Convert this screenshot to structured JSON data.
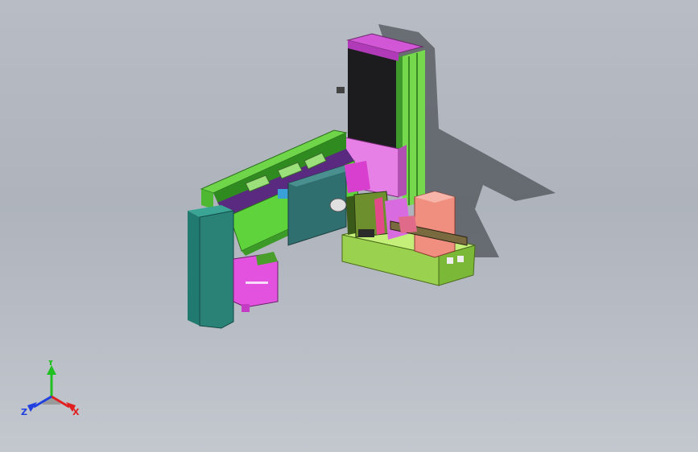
{
  "viewport": {
    "background_top": "#b8bcc4",
    "background_bottom": "#c3c7ce"
  },
  "model": {
    "parts": [
      {
        "name": "vertical-column",
        "color": "#2f2f33"
      },
      {
        "name": "column-cap",
        "color": "#d157d6"
      },
      {
        "name": "column-rail",
        "color": "#6fd64a"
      },
      {
        "name": "horizontal-beam",
        "color": "#5ed33c"
      },
      {
        "name": "carriage-plate",
        "color": "#2f6f6f"
      },
      {
        "name": "end-block",
        "color": "#2a8277"
      },
      {
        "name": "motor-housing",
        "color": "#e252de"
      },
      {
        "name": "base-plate",
        "color": "#a6e35c"
      },
      {
        "name": "cylinder",
        "color": "#f08f80"
      },
      {
        "name": "gripper-head",
        "color": "#6d8f2e"
      },
      {
        "name": "connector-block",
        "color": "#e24a8a"
      }
    ]
  },
  "triad": {
    "x_label": "X",
    "y_label": "Y",
    "z_label": "Z",
    "x_color": "#e02020",
    "y_color": "#20c020",
    "z_color": "#2040e0"
  }
}
